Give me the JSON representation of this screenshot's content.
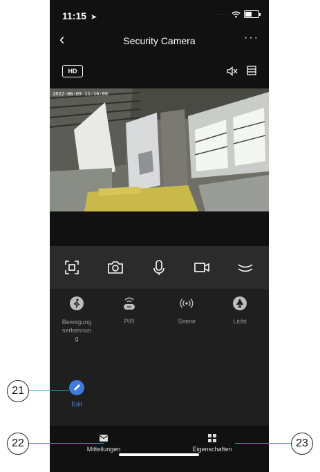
{
  "status_bar": {
    "time": "11:15",
    "location_arrow": "➤"
  },
  "nav": {
    "back_icon": "chevron-left-icon",
    "title": "Security Camera",
    "more_label": "···"
  },
  "video_toolbar": {
    "hd_label": "HD"
  },
  "video": {
    "timestamp": "2022-08-09 11:16:00"
  },
  "controls": [
    "screenshot-frame-icon",
    "camera-icon",
    "microphone-icon",
    "video-record-icon",
    "collapse-icon"
  ],
  "features": [
    {
      "label": "Bewegung\nserkennun\ng",
      "icon": "motion-detection-icon"
    },
    {
      "label": "PIR",
      "icon": "pir-sensor-icon"
    },
    {
      "label": "Sirene",
      "icon": "siren-icon"
    },
    {
      "label": "Licht",
      "icon": "light-icon"
    }
  ],
  "edit": {
    "label": "Edit"
  },
  "tabs": {
    "messages": {
      "label": "Mitteilungen"
    },
    "properties": {
      "label": "Eigenschaften"
    }
  },
  "callouts": {
    "edit": "21",
    "messages": "22",
    "properties": "23"
  },
  "colors": {
    "accent": "#3d7be0",
    "callout_line": "#29a3b5",
    "background": "#1f1f1f"
  }
}
